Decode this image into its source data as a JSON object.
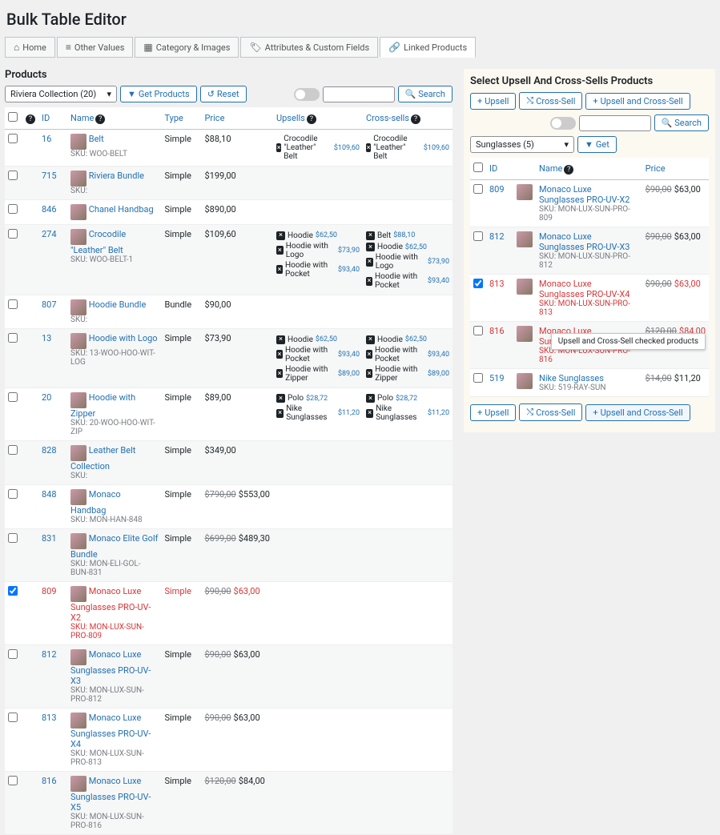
{
  "title": "Bulk Table Editor",
  "tabs": [
    {
      "icon": "⌂",
      "label": "Home"
    },
    {
      "icon": "≡",
      "label": "Other Values"
    },
    {
      "icon": "▦",
      "label": "Category & Images"
    },
    {
      "icon": "🏷",
      "label": "Attributes & Custom Fields"
    },
    {
      "icon": "🔗",
      "label": "Linked Products"
    }
  ],
  "active_tab": 4,
  "left": {
    "heading": "Products",
    "filter": "Riviera Collection  (20)",
    "getProducts": "Get Products",
    "reset": "Reset",
    "searchPlaceholder": "",
    "searchBtn": "Search",
    "cols": {
      "id": "ID",
      "name": "Name",
      "type": "Type",
      "price": "Price",
      "upsells": "Upsells",
      "cross": "Cross-sells"
    },
    "rows": [
      {
        "id": "16",
        "name": "Belt",
        "sku": "SKU: WOO-BELT",
        "type": "Simple",
        "price": "$88,10",
        "up": [
          {
            "n": "Crocodile \"Leather\" Belt",
            "p": "$109,60"
          }
        ],
        "cr": [
          {
            "n": "Crocodile \"Leather\" Belt",
            "p": "$109,60"
          }
        ]
      },
      {
        "id": "715",
        "name": "Riviera Bundle",
        "sku": "SKU:",
        "type": "Simple",
        "price": "$199,00"
      },
      {
        "id": "846",
        "name": "Chanel Handbag",
        "sku": "",
        "type": "Simple",
        "price": "$890,00"
      },
      {
        "id": "274",
        "name": "Crocodile \"Leather\" Belt",
        "sku": "SKU: WOO-BELT-1",
        "type": "Simple",
        "price": "$109,60",
        "up": [
          {
            "n": "Hoodie",
            "p": "$62,50"
          },
          {
            "n": "Hoodie with Logo",
            "p": "$73,90"
          },
          {
            "n": "Hoodie with Pocket",
            "p": "$93,40"
          }
        ],
        "cr": [
          {
            "n": "Belt",
            "p": "$88,10"
          },
          {
            "n": "Hoodie",
            "p": "$62,50"
          },
          {
            "n": "Hoodie with Logo",
            "p": "$73,90"
          },
          {
            "n": "Hoodie with Pocket",
            "p": "$93,40"
          }
        ]
      },
      {
        "id": "807",
        "name": "Hoodie Bundle",
        "sku": "SKU:",
        "type": "Bundle",
        "price": "$90,00"
      },
      {
        "id": "13",
        "name": "Hoodie with Logo",
        "sku": "SKU: 13-WOO-HOO-WIT-LOG",
        "type": "Simple",
        "price": "$73,90",
        "up": [
          {
            "n": "Hoodie",
            "p": "$62,50"
          },
          {
            "n": "Hoodie with Pocket",
            "p": "$93,40"
          },
          {
            "n": "Hoodie with Zipper",
            "p": "$89,00"
          }
        ],
        "cr": [
          {
            "n": "Hoodie",
            "p": "$62,50"
          },
          {
            "n": "Hoodie with Pocket",
            "p": "$93,40"
          },
          {
            "n": "Hoodie with Zipper",
            "p": "$89,00"
          }
        ]
      },
      {
        "id": "20",
        "name": "Hoodie with Zipper",
        "sku": "SKU: 20-WOO-HOO-WIT-ZIP",
        "type": "Simple",
        "price": "$89,00",
        "up": [
          {
            "n": "Polo",
            "p": "$28,72"
          },
          {
            "n": "Nike Sunglasses",
            "p": "$11,20"
          }
        ],
        "cr": [
          {
            "n": "Polo",
            "p": "$28,72"
          },
          {
            "n": "Nike Sunglasses",
            "p": "$11,20"
          }
        ]
      },
      {
        "id": "828",
        "name": "Leather Belt Collection",
        "sku": "SKU:",
        "type": "Simple",
        "price": "$349,00"
      },
      {
        "id": "848",
        "name": "Monaco Handbag",
        "sku": "SKU: MON-HAN-848",
        "type": "Simple",
        "old": "$790,00",
        "price": "$553,00"
      },
      {
        "id": "831",
        "name": "Monaco Elite Golf Bundle",
        "sku": "SKU: MON-ELI-GOL-BUN-831",
        "type": "Simple",
        "old": "$699,00",
        "price": "$489,30"
      },
      {
        "id": "809",
        "name": "Monaco Luxe Sunglasses PRO-UV-X2",
        "sku": "SKU: MON-LUX-SUN-PRO-809",
        "type": "Simple",
        "old": "$90,00",
        "price": "$63,00",
        "hl": true,
        "checked": true
      },
      {
        "id": "812",
        "name": "Monaco Luxe Sunglasses PRO-UV-X3",
        "sku": "SKU: MON-LUX-SUN-PRO-812",
        "type": "Simple",
        "old": "$90,00",
        "price": "$63,00"
      },
      {
        "id": "813",
        "name": "Monaco Luxe Sunglasses PRO-UV-X4",
        "sku": "SKU: MON-LUX-SUN-PRO-813",
        "type": "Simple",
        "old": "$90,00",
        "price": "$63,00"
      },
      {
        "id": "816",
        "name": "Monaco Luxe Sunglasses PRO-UV-X5",
        "sku": "SKU: MON-LUX-SUN-PRO-816",
        "type": "Simple",
        "old": "$120,00",
        "price": "$84,00"
      }
    ]
  },
  "right": {
    "heading": "Select Upsell And Cross-Sells Products",
    "upsell": "Upsell",
    "cross": "Cross-Sell",
    "both": "Upsell and Cross-Sell",
    "searchBtn": "Search",
    "filter": "Sunglasses  (5)",
    "get": "Get",
    "cols": {
      "id": "ID",
      "name": "Name",
      "price": "Price"
    },
    "rows": [
      {
        "id": "809",
        "name": "Monaco Luxe Sunglasses PRO-UV-X2",
        "sku": "SKU: MON-LUX-SUN-PRO-809",
        "old": "$90,00",
        "price": "$63,00"
      },
      {
        "id": "812",
        "name": "Monaco Luxe Sunglasses PRO-UV-X3",
        "sku": "SKU: MON-LUX-SUN-PRO-812",
        "old": "$90,00",
        "price": "$63,00"
      },
      {
        "id": "813",
        "name": "Monaco Luxe Sunglasses PRO-UV-X4",
        "sku": "SKU: MON-LUX-SUN-PRO-813",
        "old": "$90,00",
        "price": "$63,00",
        "hl": true,
        "checked": true
      },
      {
        "id": "816",
        "name": "Monaco Luxe Sunglasses PRO-UV-X5",
        "sku": "SKU: MON-LUX-SUN-PRO-816",
        "old": "$120,00",
        "price": "$84,00",
        "hl": true
      },
      {
        "id": "519",
        "name": "Nike Sunglasses",
        "sku": "SKU: 519-RAY-SUN",
        "old": "$14,00",
        "price": "$11,20"
      }
    ],
    "tooltip": "Upsell and Cross-Sell checked products"
  }
}
